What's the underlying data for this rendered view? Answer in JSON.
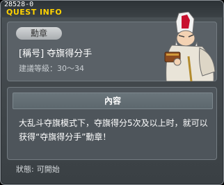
{
  "window": {
    "quest_id": "28528-0",
    "title": "QUEST INFO"
  },
  "medal_info": {
    "tag": "勳章",
    "name": "[稱号] 夺旗得分手",
    "level_label": "建議等級：",
    "level_range": "30～34"
  },
  "content": {
    "header": "內容",
    "description": "大乱斗夺旗模式下，夺旗得分5次及以上时，就可以获得“夺旗得分手”勳章！"
  },
  "status": {
    "label": "狀態:",
    "value": "可開始"
  },
  "colors": {
    "title": "#ffd200",
    "panel": "#5a6167"
  }
}
